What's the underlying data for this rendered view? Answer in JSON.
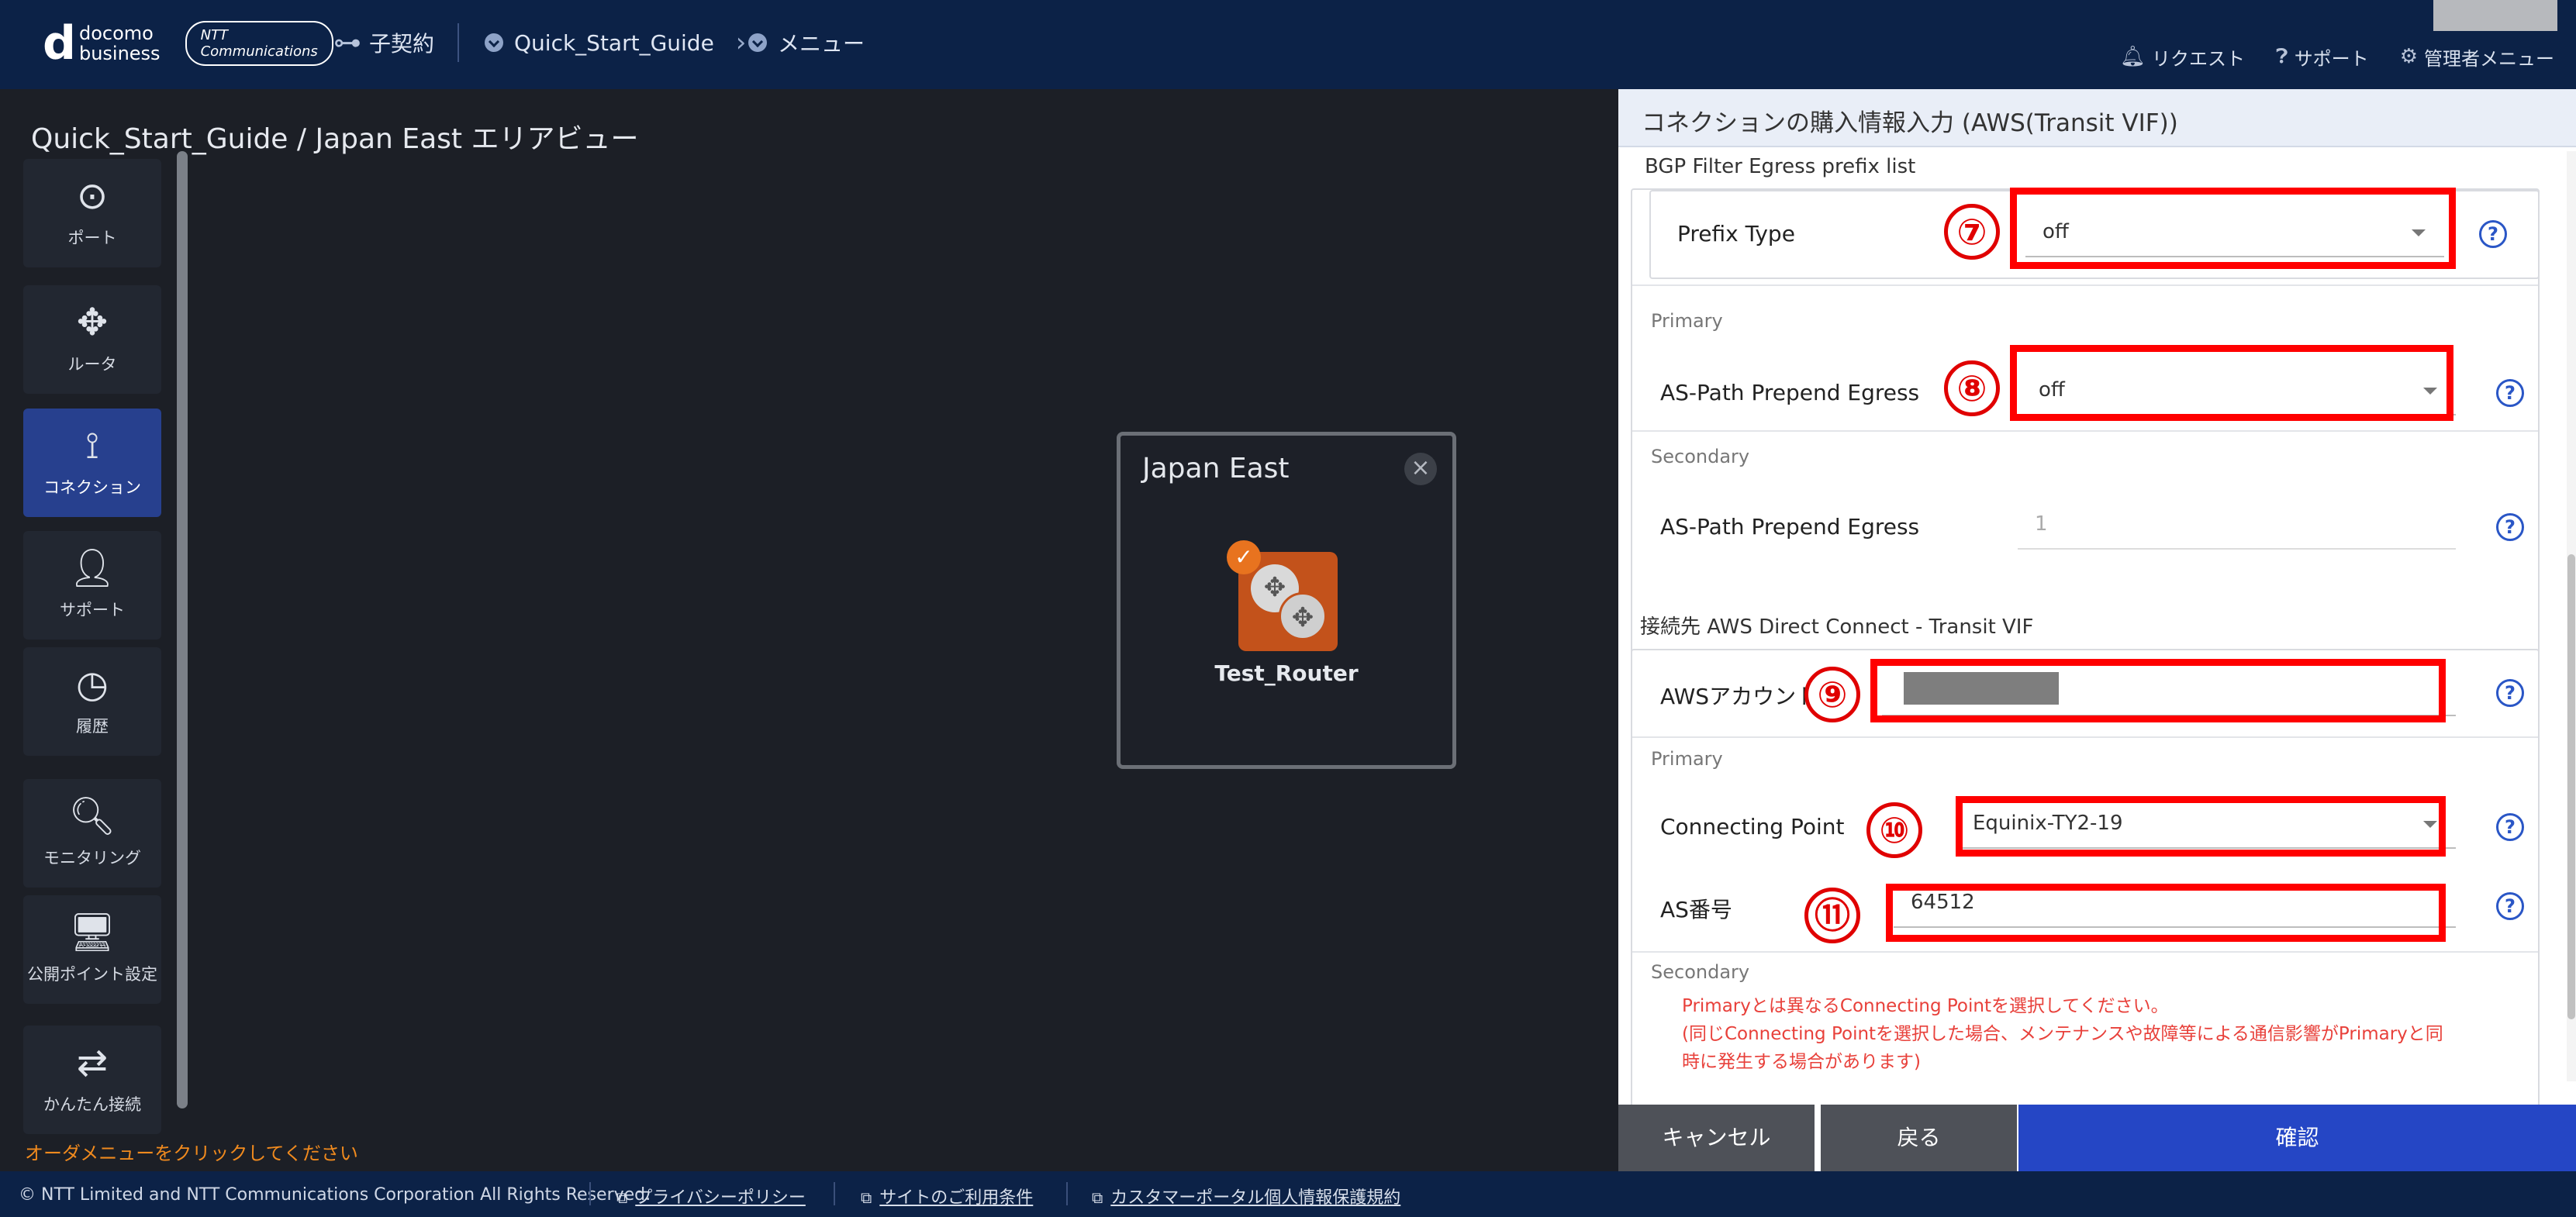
{
  "header": {
    "logo_d": "d",
    "logo_line1": "docomo",
    "logo_line2": "business",
    "logo_ntt": "NTT Communications",
    "nav_contract": "子契約",
    "nav_guide": "Quick_Start_Guide",
    "nav_menu": "メニュー",
    "request": "リクエスト",
    "support": "サポート",
    "admin_menu": "管理者メニュー"
  },
  "canvas": {
    "title": "Quick_Start_Guide / Japan East エリアビュー",
    "hint": "オーダメニューをクリックしてください",
    "area_title": "Japan East",
    "router_label": "Test_Router"
  },
  "sidebar": {
    "items": [
      {
        "label": "ポート",
        "icon": "port-icon"
      },
      {
        "label": "ルータ",
        "icon": "router-icon"
      },
      {
        "label": "コネクション",
        "icon": "connection-icon"
      },
      {
        "label": "サポート",
        "icon": "support-user-icon"
      },
      {
        "label": "履歴",
        "icon": "history-icon"
      },
      {
        "label": "モニタリング",
        "icon": "monitoring-icon"
      },
      {
        "label": "公開ポイント設定",
        "icon": "monitor-icon"
      },
      {
        "label": "かんたん接続",
        "icon": "easy-connect-icon"
      }
    ]
  },
  "panel": {
    "title": "コネクションの購入情報入力 (AWS(Transit VIF))",
    "bgp_section": "BGP Filter Egress prefix list",
    "prefix_type_label": "Prefix Type",
    "prefix_type_value": "off",
    "primary": "Primary",
    "secondary": "Secondary",
    "as_path_label": "AS-Path Prepend Egress",
    "as_path_primary_value": "off",
    "as_path_secondary_value": "1",
    "aws_section": "接続先 AWS Direct Connect - Transit VIF",
    "aws_account_label": "AWSアカウントID",
    "connecting_point_label": "Connecting Point",
    "connecting_point_value": "Equinix-TY2-19",
    "as_number_label": "AS番号",
    "as_number_value": "64512",
    "warning_line1": "Primaryとは異なるConnecting Pointを選択してください。",
    "warning_line2": "(同じConnecting Pointを選択した場合、メンテナンスや故障等による通信影響がPrimaryと同",
    "warning_line3": "時に発生する場合があります)",
    "markers": [
      "⑦",
      "⑧",
      "⑨",
      "⑩",
      "⑪"
    ],
    "help": "?"
  },
  "buttons": {
    "cancel": "キャンセル",
    "back": "戻る",
    "confirm": "確認"
  },
  "footer": {
    "copyright": "© NTT Limited and NTT Communications Corporation All Rights Reserved.",
    "privacy": "プライバシーポリシー",
    "terms": "サイトのご利用条件",
    "customer_privacy": "カスタマーポータル個人情報保護規約"
  },
  "colors": {
    "header_bg": "#0c2247",
    "accent_blue": "#2546c5",
    "highlight_red": "#ff0000",
    "router_orange": "#c3521b"
  }
}
